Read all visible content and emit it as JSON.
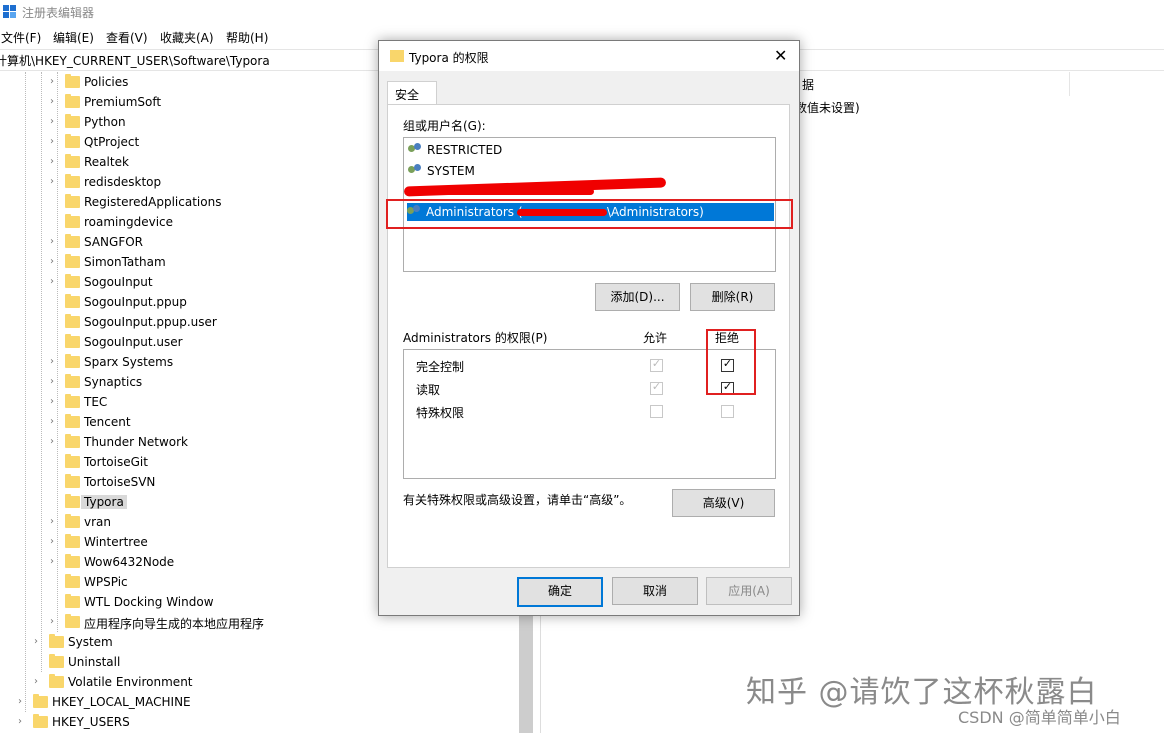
{
  "window": {
    "title": "注册表编辑器"
  },
  "menu": [
    "文件(F)",
    "编辑(E)",
    "查看(V)",
    "收藏夹(A)",
    "帮助(H)"
  ],
  "address": "计算机\\HKEY_CURRENT_USER\\Software\\Typora",
  "tree": {
    "software_children": [
      "Policies",
      "PremiumSoft",
      "Python",
      "QtProject",
      "Realtek",
      "redisdesktop",
      "RegisteredApplications",
      "roamingdevice",
      "SANGFOR",
      "SimonTatham",
      "SogouInput",
      "SogouInput.ppup",
      "SogouInput.ppup.user",
      "SogouInput.user",
      "Sparx Systems",
      "Synaptics",
      "TEC",
      "Tencent",
      "Thunder Network",
      "TortoiseGit",
      "TortoiseSVN",
      "Typora",
      "vran",
      "Wintertree",
      "Wow6432Node",
      "WPSPic",
      "WTL Docking Window",
      "应用程序向导生成的本地应用程序"
    ],
    "user_children": [
      "System",
      "Uninstall",
      "Volatile Environment"
    ],
    "roots": [
      "HKEY_LOCAL_MACHINE",
      "HKEY_USERS"
    ],
    "selected": "Typora"
  },
  "right_pane": {
    "header_fragment": "据",
    "value_fragment": "数值未设置)"
  },
  "dialog": {
    "title": "Typora 的权限",
    "tab": "安全",
    "group_label": "组或用户名(G):",
    "users": [
      "RESTRICTED",
      "SYSTEM",
      "Administrators (\\Administrators)"
    ],
    "selected_user_left": "Administrators (",
    "selected_user_right": "\\Administrators)",
    "add_button": "添加(D)...",
    "remove_button": "删除(R)",
    "perm_label": "Administrators 的权限(P)",
    "allow_header": "允许",
    "deny_header": "拒绝",
    "permissions": [
      {
        "name": "完全控制",
        "allow": true,
        "deny": true
      },
      {
        "name": "读取",
        "allow": true,
        "deny": true
      },
      {
        "name": "特殊权限",
        "allow": false,
        "deny": false
      }
    ],
    "advanced_note": "有关特殊权限或高级设置，请单击“高级”。",
    "advanced_button": "高级(V)",
    "ok_button": "确定",
    "cancel_button": "取消",
    "apply_button": "应用(A)"
  },
  "watermarks": {
    "zhihu": "知乎 @请饮了这杯秋露白",
    "csdn": "CSDN @简单简单小白"
  },
  "colors": {
    "selection": "#0078d7",
    "folder": "#f9d66b",
    "annotation": "#e02020"
  }
}
